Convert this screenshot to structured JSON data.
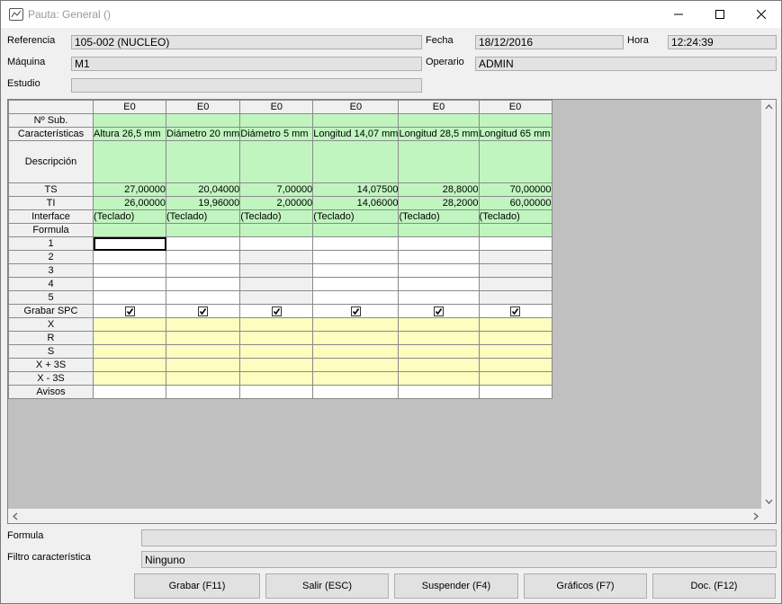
{
  "window": {
    "title": "Pauta: General ()"
  },
  "header": {
    "referencia_label": "Referencia",
    "referencia_value": "105-002 (NUCLEO)",
    "fecha_label": "Fecha",
    "fecha_value": "18/12/2016",
    "hora_label": "Hora",
    "hora_value": "12:24:39",
    "maquina_label": "Máquina",
    "maquina_value": "M1",
    "operario_label": "Operario",
    "operario_value": "ADMIN",
    "estudio_label": "Estudio",
    "estudio_value": ""
  },
  "grid": {
    "column_headers": [
      "E0",
      "E0",
      "E0",
      "E0",
      "E0",
      "E0"
    ],
    "row_labels": {
      "nsub": "Nº Sub.",
      "caracteristicas": "Características",
      "descripcion": "Descripción",
      "ts": "TS",
      "ti": "TI",
      "interface": "Interface",
      "formula": "Formula",
      "r1": "1",
      "r2": "2",
      "r3": "3",
      "r4": "4",
      "r5": "5",
      "grabar_spc": "Grabar SPC",
      "x": "X",
      "r": "R",
      "s": "S",
      "x_plus_3s": "X + 3S",
      "x_minus_3s": "X - 3S",
      "avisos": "Avisos"
    },
    "caracteristicas": [
      "Altura 26,5 mm",
      "Diámetro 20 mm",
      "Diámetro 5 mm",
      "Longitud 14,07 mm",
      "Longitud 28,5 mm",
      "Longitud 65 mm"
    ],
    "ts": [
      "27,00000",
      "20,04000",
      "7,00000",
      "14,07500",
      "28,8000",
      "70,00000"
    ],
    "ti": [
      "26,00000",
      "19,96000",
      "2,00000",
      "14,06000",
      "28,2000",
      "60,00000"
    ],
    "interface": [
      "(Teclado)",
      "(Teclado)",
      "(Teclado)",
      "(Teclado)",
      "(Teclado)",
      "(Teclado)"
    ],
    "grabar_spc": [
      true,
      true,
      true,
      true,
      true,
      true
    ]
  },
  "footer": {
    "formula_label": "Formula",
    "formula_value": "",
    "filtro_label": "Filtro característica",
    "filtro_value": "Ninguno"
  },
  "buttons": {
    "grabar": "Grabar (F11)",
    "salir": "Salir (ESC)",
    "suspender": "Suspender (F4)",
    "graficos": "Gráficos (F7)",
    "doc": "Doc. (F12)"
  }
}
